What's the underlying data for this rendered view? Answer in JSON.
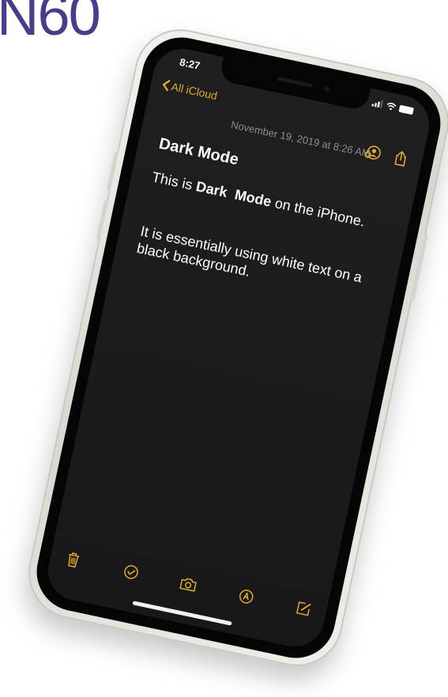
{
  "brand": {
    "text": "N60"
  },
  "colors": {
    "accent": "#e0ab2e",
    "screen_background": "#1c1c1f",
    "text_primary": "#ffffff",
    "text_secondary": "#8d8d92",
    "brand_text": "#4a3c86"
  },
  "status_bar": {
    "time": "8:27",
    "icons": [
      "cellular-signal-icon",
      "wifi-icon",
      "battery-icon"
    ]
  },
  "nav": {
    "back_label": "All iCloud",
    "back_icon": "chevron-left-icon",
    "actions": [
      "add-people-icon",
      "share-icon"
    ]
  },
  "note": {
    "date": "November 19, 2019 at 8:26 AM",
    "title": "Dark Mode",
    "para1_prefix": "This is ",
    "para1_bold": "Dark  Mode",
    "para1_suffix": " on the iPhone.",
    "para2": "It is essentially using white text on a black background."
  },
  "toolbar": {
    "icons": [
      "trash-icon",
      "checklist-icon",
      "camera-icon",
      "markup-icon",
      "compose-icon"
    ]
  }
}
